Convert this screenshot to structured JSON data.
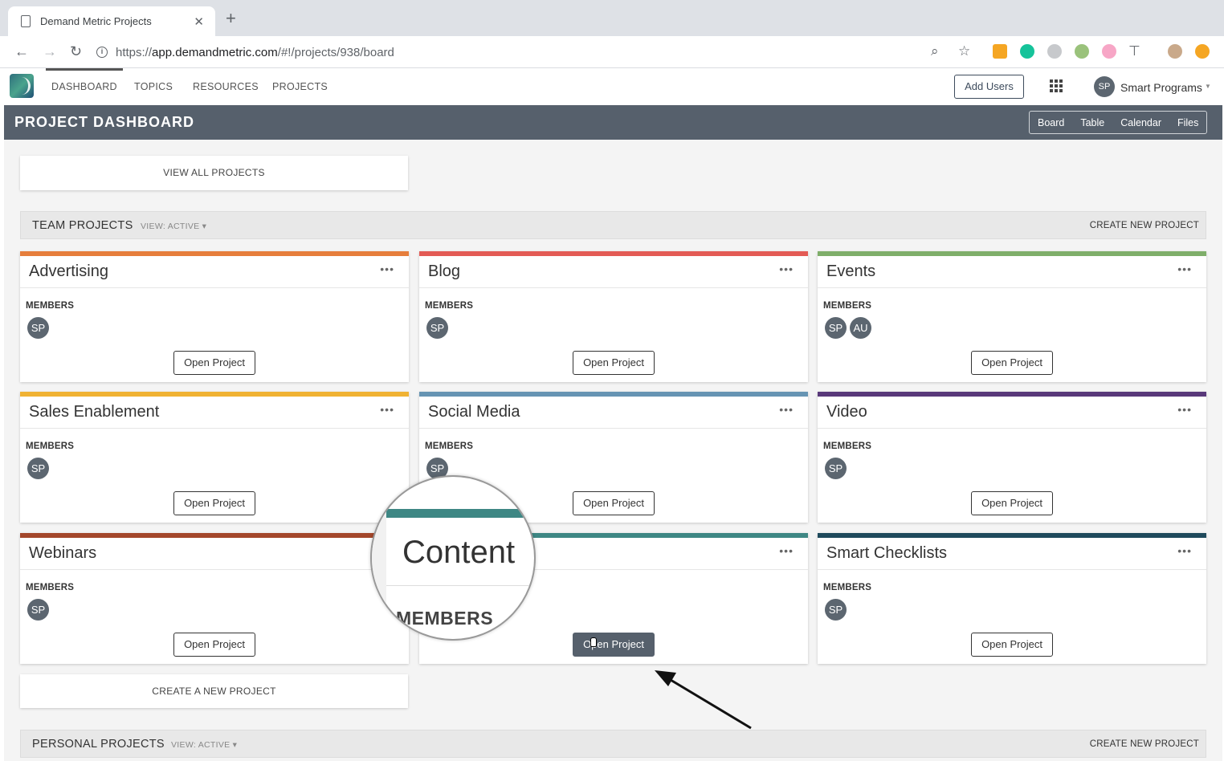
{
  "browser": {
    "tab_title": "Demand Metric Projects",
    "tab_close": "✕",
    "new_tab": "+",
    "url_prefix": "https://",
    "url_domain": "app.demandmetric.com",
    "url_path": "/#!/projects/938/board"
  },
  "nav": {
    "items": [
      "DASHBOARD",
      "TOPICS",
      "RESOURCES",
      "PROJECTS"
    ],
    "add_users": "Add Users",
    "user_initials": "SP",
    "user_name": "Smart Programs"
  },
  "header": {
    "title": "PROJECT DASHBOARD",
    "views": [
      "Board",
      "Table",
      "Calendar",
      "Files"
    ]
  },
  "view_all": "VIEW ALL PROJECTS",
  "team_section": {
    "label": "TEAM PROJECTS",
    "view": "VIEW: ACTIVE ▾",
    "create": "CREATE NEW PROJECT"
  },
  "cards": [
    {
      "title": "Advertising",
      "color": "#e67e3c",
      "members": [
        "SP"
      ]
    },
    {
      "title": "Blog",
      "color": "#e35b55",
      "members": [
        "SP"
      ]
    },
    {
      "title": "Events",
      "color": "#7fae6a",
      "members": [
        "SP",
        "AU"
      ]
    },
    {
      "title": "Sales Enablement",
      "color": "#f0b233",
      "members": [
        "SP"
      ]
    },
    {
      "title": "Social Media",
      "color": "#6694b3",
      "members": [
        "SP"
      ]
    },
    {
      "title": "Video",
      "color": "#59397a",
      "members": [
        "SP"
      ]
    },
    {
      "title": "Webinars",
      "color": "#a3472b",
      "members": [
        "SP"
      ]
    },
    {
      "title": "Content",
      "color": "#3e8784",
      "members": []
    },
    {
      "title": "Smart Checklists",
      "color": "#1f4a5c",
      "members": [
        "SP"
      ]
    }
  ],
  "card_labels": {
    "members": "MEMBERS",
    "open": "Open Project",
    "menu": "•••"
  },
  "create_new": "CREATE A NEW PROJECT",
  "personal_section": {
    "label": "PERSONAL PROJECTS",
    "view": "VIEW: ACTIVE ▾",
    "create": "CREATE NEW PROJECT"
  },
  "magnifier": {
    "title": "Content",
    "members_label": "MEMBERS"
  }
}
